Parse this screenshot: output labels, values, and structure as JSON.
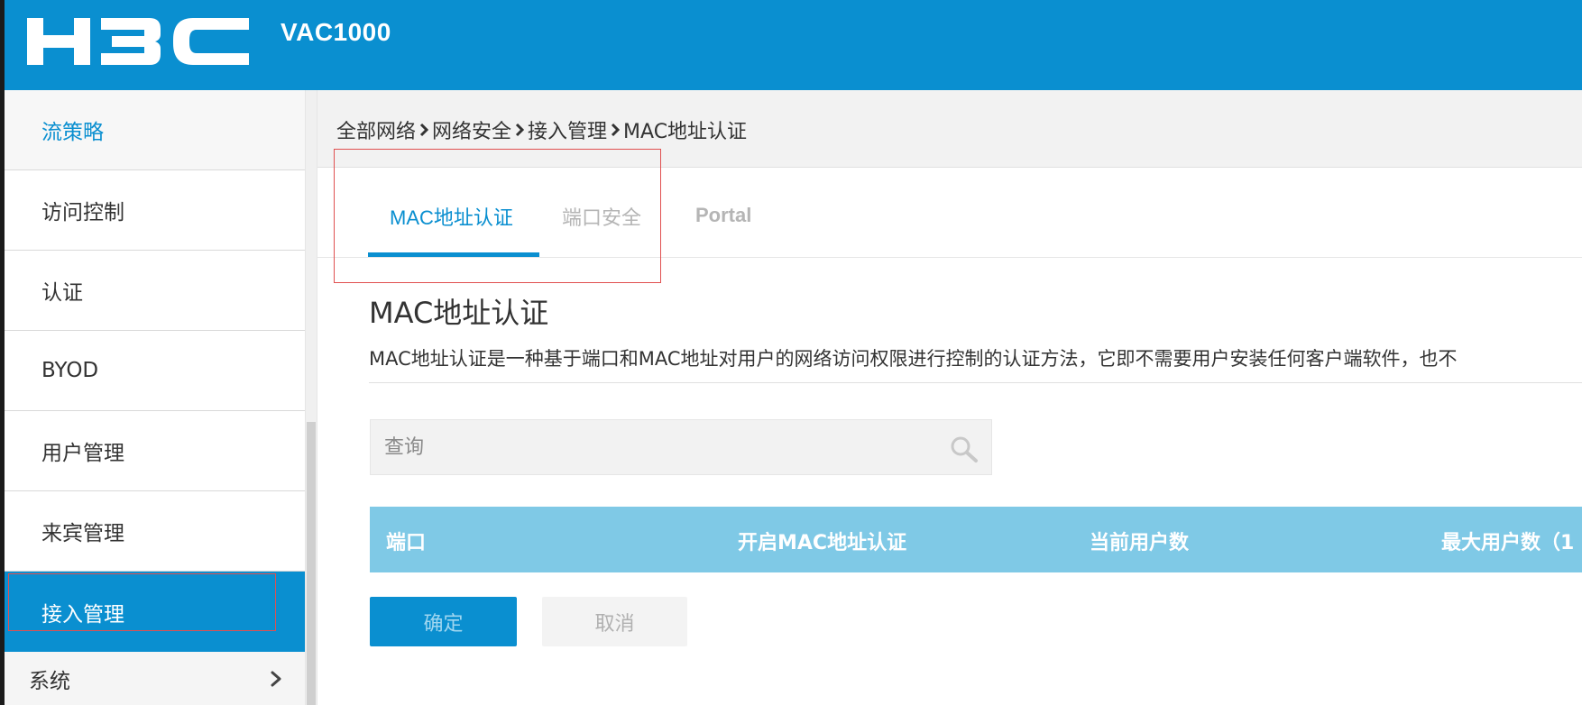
{
  "header": {
    "logo_text": "H3C",
    "product_name": "VAC1000",
    "brand_color": "#0a8fd0"
  },
  "sidebar": {
    "items": [
      {
        "label": "流策略"
      },
      {
        "label": "访问控制"
      },
      {
        "label": "认证"
      },
      {
        "label": "BYOD"
      },
      {
        "label": "用户管理"
      },
      {
        "label": "来宾管理"
      },
      {
        "label": "接入管理",
        "active": true
      },
      {
        "label": "系统",
        "icon": "chevron-right-icon"
      }
    ]
  },
  "breadcrumb": {
    "items": [
      "全部网络",
      "网络安全",
      "接入管理",
      "MAC地址认证"
    ],
    "separator_icon": "chevron-right-icon"
  },
  "tabs": [
    {
      "label": "MAC地址认证",
      "active": true
    },
    {
      "label": "端口安全",
      "active": false
    },
    {
      "label": "Portal",
      "active": false
    }
  ],
  "section": {
    "title": "MAC地址认证",
    "description": "MAC地址认证是一种基于端口和MAC地址对用户的网络访问权限进行控制的认证方法，它即不需要用户安装任何客户端软件，也不"
  },
  "search": {
    "placeholder": "查询",
    "value": "",
    "icon": "search-icon"
  },
  "table": {
    "columns": [
      "端口",
      "开启MAC地址认证",
      "当前用户数",
      "最大用户数（1"
    ],
    "header_color": "#7fc9e6"
  },
  "buttons": {
    "confirm_label": "确定",
    "cancel_label": "取消"
  },
  "colors": {
    "accent": "#0a8fd0",
    "highlight_border": "#e05050"
  }
}
